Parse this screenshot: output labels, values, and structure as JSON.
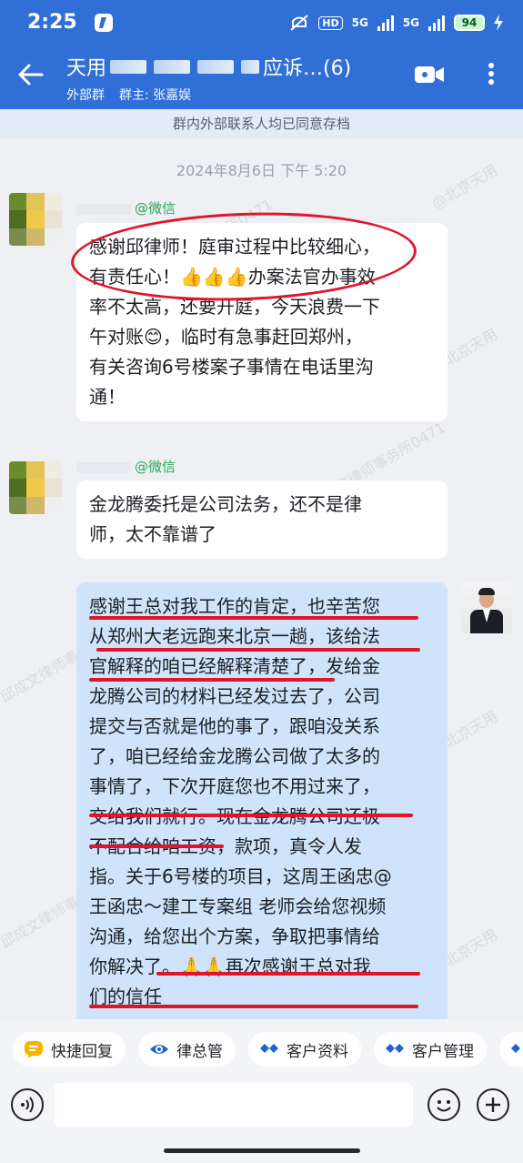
{
  "status_bar": {
    "time": "2:25",
    "hd_label": "HD",
    "net_label_1": "5G",
    "net_label_2": "5G",
    "battery": "94"
  },
  "header": {
    "title_prefix": "天用",
    "title_suffix": "应诉…(6)",
    "group_type": "外部群",
    "owner": "群主: 张嘉娱"
  },
  "notice": "群内外部联系人均已同意存档",
  "chat": {
    "timestamp": "2024年8月6日  下午 5:20",
    "watermarks": [
      "邱成文律师事务所0471",
      "@北京天用",
      "邱成文律师事务所0471",
      "@北京天用",
      "邱成文律师事务所0471",
      "@北京天用",
      "邱成文律师事务所0471",
      "@北京天用"
    ],
    "messages": [
      {
        "sender_tag": "@微信",
        "lines": [
          "感谢邱律师！庭审过程中比较细心，",
          "有责任心！👍👍👍办案法官办事效",
          "率不太高，还要开庭，今天浪费一下",
          "午对账😊，临时有急事赶回郑州，",
          "有关咨询6号楼案子事情在电话里沟",
          "通！"
        ]
      },
      {
        "sender_tag": "@微信",
        "lines": [
          "金龙腾委托是公司法务，还不是律",
          "师，太不靠谱了"
        ]
      },
      {
        "lines": [
          "感谢王总对我工作的肯定，也辛苦您",
          "从郑州大老远跑来北京一趟，该给法",
          "官解释的咱已经解释清楚了，发给金",
          "龙腾公司的材料已经发过去了，公司",
          "提交与否就是他的事了，跟咱没关系",
          "了，咱已经给金龙腾公司做了太多的",
          "事情了，下次开庭您也不用过来了，",
          "交给我们就行。现在金龙腾公司还极",
          "不配合给咱工资，款项，真令人发",
          "指。关于6号楼的项目，这周王函忠@",
          "王函忠～建工专案组 老师会给您视频",
          "沟通，给您出个方案，争取把事情给",
          "你解决了。🙏🙏再次感谢王总对我",
          "们的信任"
        ]
      }
    ]
  },
  "quick_actions": [
    "快捷回复",
    "律总管",
    "客户资料",
    "客户管理"
  ],
  "colors": {
    "header_blue": "#2f6fd6",
    "my_bubble": "#cfe4fb",
    "annotation_red": "#e0152b",
    "wechat_green": "#2aa55b"
  }
}
